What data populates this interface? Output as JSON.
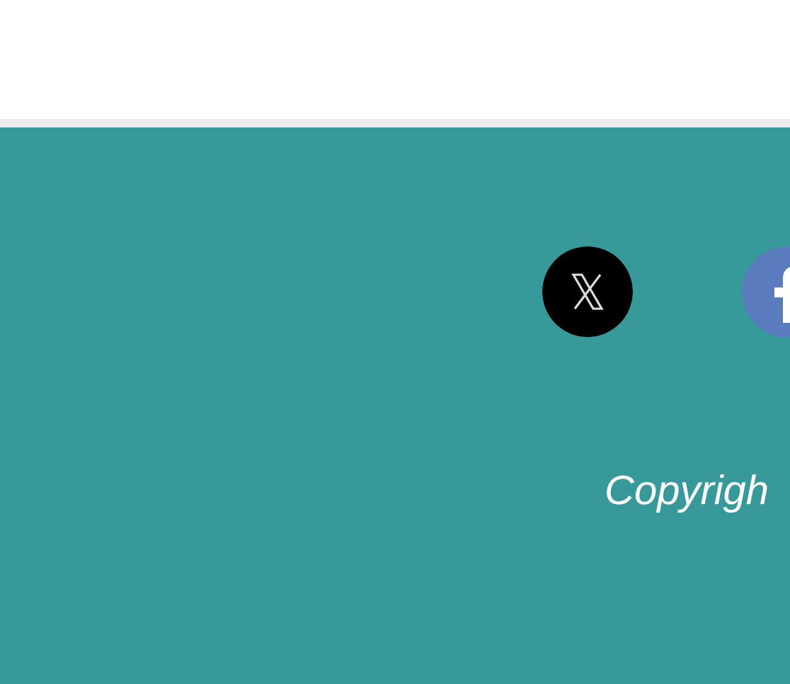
{
  "footer": {
    "copyright": "Copyrigh"
  }
}
